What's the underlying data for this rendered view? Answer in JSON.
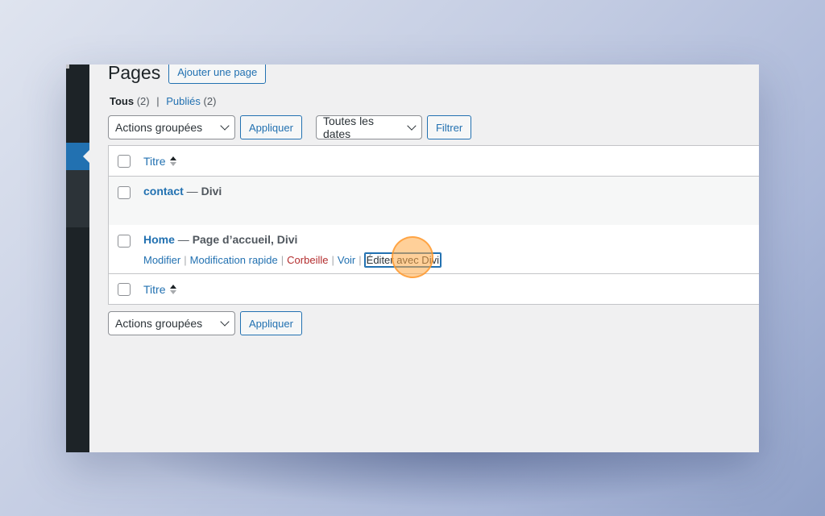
{
  "page": {
    "title": "Pages",
    "add_button": "Ajouter une page"
  },
  "views": {
    "all_label": "Tous",
    "all_count": "(2)",
    "separator": "|",
    "published_label": "Publiés",
    "published_count": "(2)"
  },
  "top_nav": {
    "bulk_actions": "Actions groupées",
    "apply": "Appliquer",
    "dates_filter": "Toutes les dates",
    "filter": "Filtrer"
  },
  "table": {
    "column_title": "Titre",
    "rows": [
      {
        "title": "contact",
        "suffix_dash": " — ",
        "state": "Divi"
      },
      {
        "title": "Home",
        "suffix_dash": " — ",
        "state": "Page d’accueil, Divi",
        "actions": {
          "edit": "Modifier",
          "quick_edit": "Modification rapide",
          "trash": "Corbeille",
          "view": "Voir",
          "edit_divi": "Éditer avec Divi",
          "separator": "|"
        }
      }
    ]
  },
  "bottom_nav": {
    "bulk_actions": "Actions groupées",
    "apply": "Appliquer"
  },
  "colors": {
    "accent": "#2271b1",
    "sidebar": "#1d2327",
    "trash": "#b32d2e",
    "click_marker": "#ffaa46"
  }
}
